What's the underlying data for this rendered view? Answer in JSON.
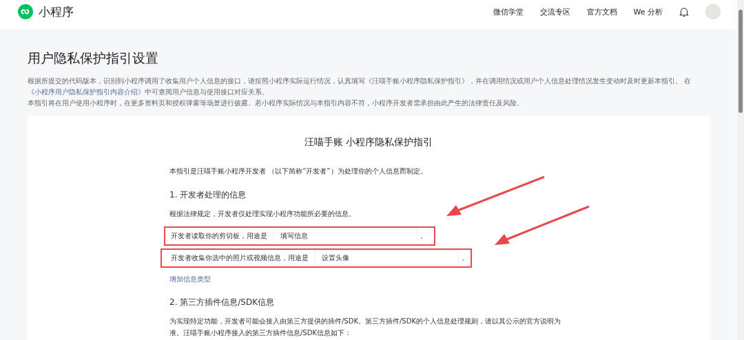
{
  "header": {
    "logo_text": "小程序",
    "nav": [
      "微信学堂",
      "交流专区",
      "官方文档",
      "We 分析"
    ]
  },
  "page": {
    "title": "用户隐私保护指引设置",
    "intro": {
      "before": "根据所提交的代码版本，识别到小程序调用了收集用户个人信息的接口，请按照小程序实际运行情况，认真填写《汪喵手账小程序隐私保护指引》，并在调用情况或用户个人信息处理情况发生变动时及时更新本指引。 在",
      "link": "《小程序用户隐私保护指引内容介绍》",
      "after": "中可查阅用户信息与使用接口对应关系。"
    },
    "notice": "本指引将在用户使用小程序时，在更多资料页和授权弹窗等场景进行披露。若小程序实际情况与本指引内容不符，小程序开发者需承担由此产生的法律责任及风险。"
  },
  "guide": {
    "title": "汪喵手账 小程序隐私保护指引",
    "lead": "本指引是汪喵手账小程序开发者 （以下简称“开发者”）为处理你的个人信息而制定。",
    "section1": {
      "heading": "1.  开发者处理的信息",
      "text": "根据法律规定，开发者仅处理实现小程序功能所必要的信息。",
      "rows": [
        {
          "label": "开发者读取你的剪切板，用途是",
          "value": "填写信息",
          "end": "。",
          "highlighted": true
        },
        {
          "label": "开发者收集你选中的照片或视频信息，用途是",
          "value": "设置头像",
          "end": "。",
          "highlighted": true
        }
      ],
      "add_link": "增加信息类型"
    },
    "section2": {
      "heading": "2.  第三方插件信息/SDK信息",
      "text": "为实现特定功能，开发者可能会接入由第三方提供的插件/SDK。第三方插件/SDK的个人信息处理规则，请以其公示的官方说明为准。汪喵手账小程序接入的第三方插件信息/SDK信息如下："
    }
  }
}
